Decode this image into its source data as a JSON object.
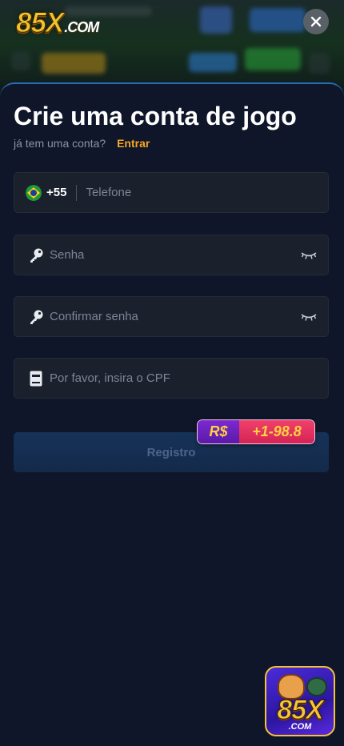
{
  "header": {
    "logo_main": "85X",
    "logo_suffix": ".COM",
    "close_label": "✕"
  },
  "form": {
    "title": "Crie uma conta de jogo",
    "have_account": "já tem uma conta?",
    "login_link": "Entrar",
    "phone": {
      "country_code": "+55",
      "placeholder": "Telefone",
      "flag_icon": "brazil-flag-icon"
    },
    "password": {
      "placeholder": "Senha",
      "icon": "key-icon",
      "toggle_icon": "eye-closed-icon"
    },
    "confirm_password": {
      "placeholder": "Confirmar senha",
      "icon": "key-icon",
      "toggle_icon": "eye-closed-icon"
    },
    "cpf": {
      "placeholder": "Por favor, insira o CPF",
      "icon": "cpf-card-icon"
    },
    "register_label": "Registro",
    "bonus": {
      "currency": "R$",
      "amount": "+1-98.8"
    }
  },
  "app_badge": {
    "main": "85X",
    "suffix": ".COM"
  },
  "colors": {
    "background": "#0f1629",
    "field": "#1a202c",
    "accent": "#f5a623",
    "register": "#173258",
    "bonus_left": "#7b2ad0",
    "bonus_right": "#e0305e"
  }
}
